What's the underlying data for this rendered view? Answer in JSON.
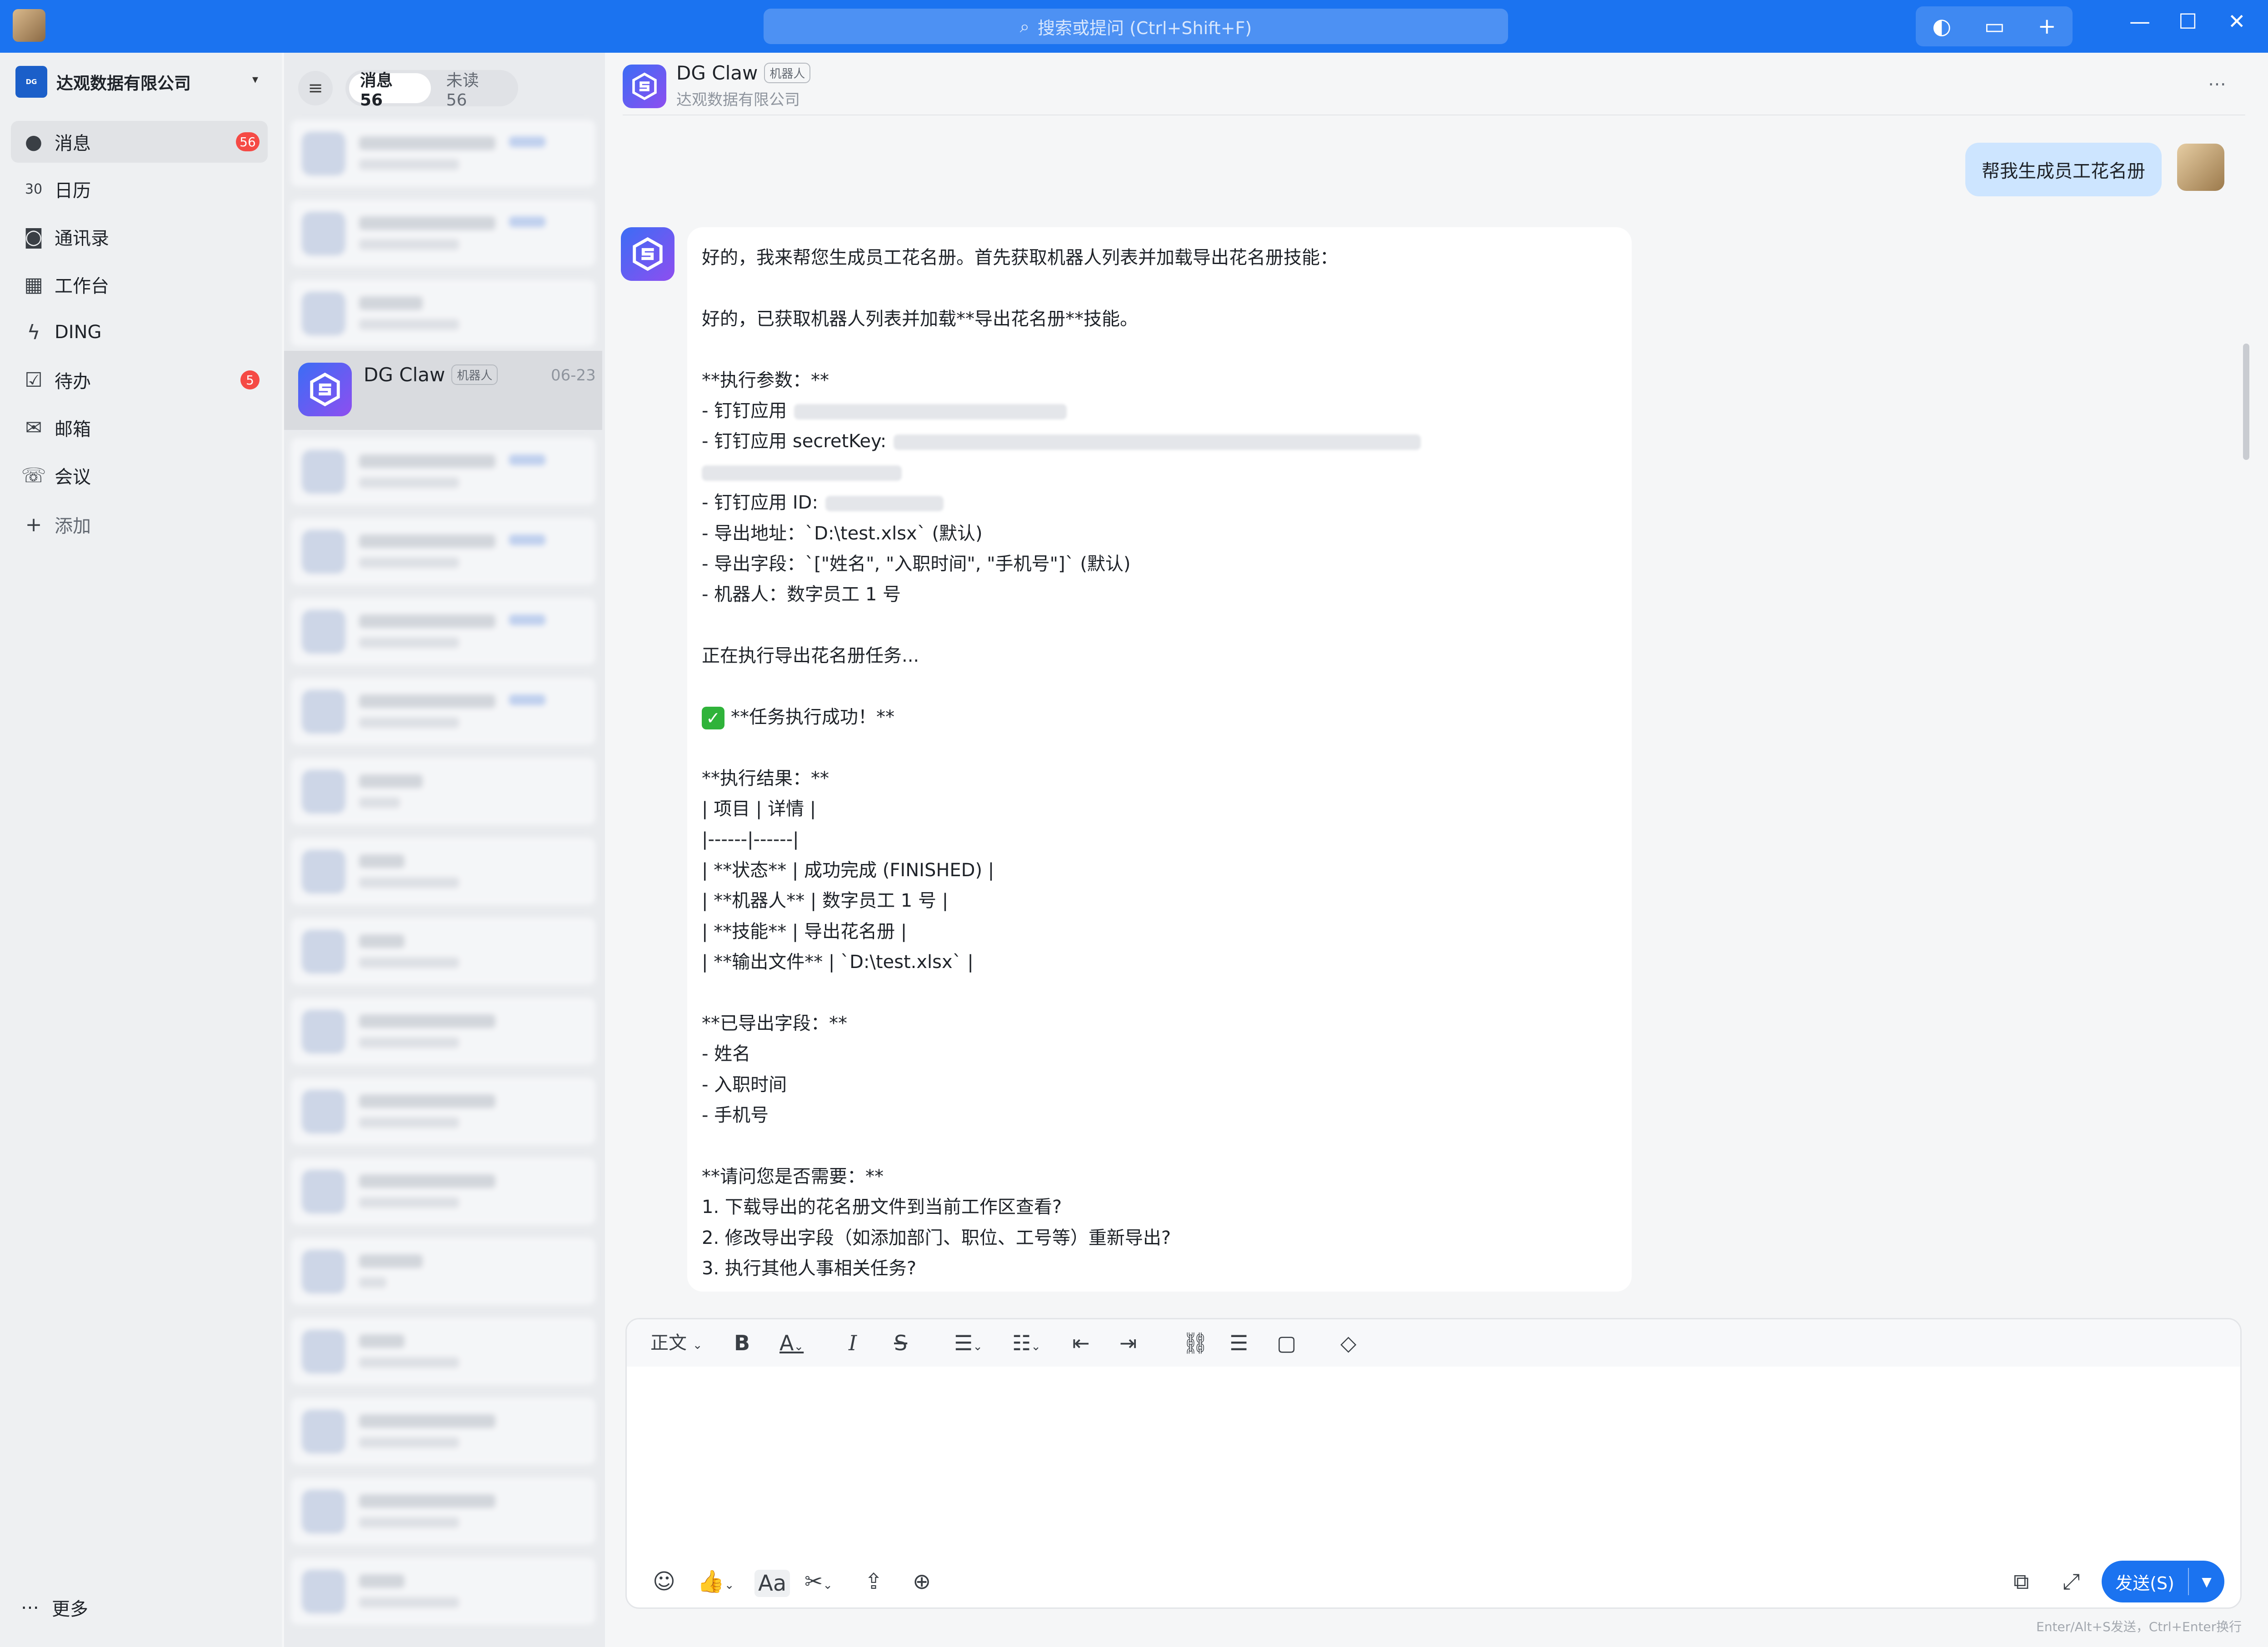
{
  "titlebar": {
    "search_placeholder": "搜索或提问 (Ctrl+Shift+F)"
  },
  "sidebar": {
    "org_name": "达观数据有限公司",
    "items": [
      {
        "label": "消息",
        "icon": "chat-bubble-icon",
        "badge": "56"
      },
      {
        "label": "日历",
        "icon": "calendar-icon",
        "icon_text": "30"
      },
      {
        "label": "通讯录",
        "icon": "contacts-icon"
      },
      {
        "label": "工作台",
        "icon": "workbench-grid-icon"
      },
      {
        "label": "DING",
        "icon": "lightning-icon"
      },
      {
        "label": "待办",
        "icon": "checkbox-icon",
        "badge": "5"
      },
      {
        "label": "邮箱",
        "icon": "mail-icon"
      },
      {
        "label": "会议",
        "icon": "meeting-phone-icon"
      },
      {
        "label": "添加",
        "icon": "plus-icon"
      }
    ],
    "more_label": "更多"
  },
  "conversation_list": {
    "tabs": [
      {
        "label": "消息 56",
        "active": true
      },
      {
        "label": "未读 56",
        "active": false
      }
    ],
    "active_item": {
      "name": "DG Claw",
      "tag": "机器人",
      "date": "06-23"
    }
  },
  "chat": {
    "header": {
      "name": "DG Claw",
      "tag": "机器人",
      "org": "达观数据有限公司"
    },
    "user_message": "帮我生成员工花名册",
    "bot_lines": [
      "好的，我来帮您生成员工花名册。首先获取机器人列表并加载导出花名册技能：",
      "",
      "好的，已获取机器人列表并加载**导出花名册**技能。",
      "",
      "**执行参数：**",
      "- 钉钉应用",
      "- 钉钉应用 secretKey:",
      "",
      "- 钉钉应用 ID:",
      "- 导出地址：`D:\\test.xlsx` (默认)",
      "- 导出字段：`[\"姓名\", \"入职时间\", \"手机号\"]` (默认)",
      "- 机器人：数字员工 1 号",
      "",
      "正在执行导出花名册任务...",
      "",
      "**任务执行成功！**",
      "",
      "**执行结果：**",
      "| 项目 | 详情 |",
      "|------|------|",
      "| **状态** | 成功完成 (FINISHED) |",
      "| **机器人** | 数字员工 1 号 |",
      "| **技能** | 导出花名册 |",
      "| **输出文件** | `D:\\test.xlsx` |",
      "",
      "**已导出字段：**",
      "- 姓名",
      "- 入职时间",
      "- 手机号",
      "",
      "**请问您是否需要：**",
      "1. 下载导出的花名册文件到当前工作区查看?",
      "2. 修改导出字段（如添加部门、职位、工号等）重新导出?",
      "3. 执行其他人事相关任务?"
    ]
  },
  "editor": {
    "style_label": "正文",
    "send_label": "发送(S)",
    "hint": "Enter/Alt+S发送，Ctrl+Enter换行",
    "format_icons": [
      "bold-icon",
      "font-color-icon",
      "italic-icon",
      "strikethrough-icon",
      "bullet-list-icon",
      "numbered-list-icon",
      "outdent-icon",
      "indent-icon",
      "link-icon",
      "divider-icon",
      "code-block-icon",
      "clear-format-icon"
    ],
    "bottom_icons": [
      "emoji-icon",
      "thumbs-up-icon",
      "text-format-icon",
      "scissors-icon",
      "upload-folder-icon",
      "plus-circle-icon",
      "image-text-icon",
      "expand-icon"
    ]
  },
  "colors": {
    "brand": "#1b73f0",
    "badge": "#f54a45",
    "user_bubble": "#cde5ff"
  }
}
